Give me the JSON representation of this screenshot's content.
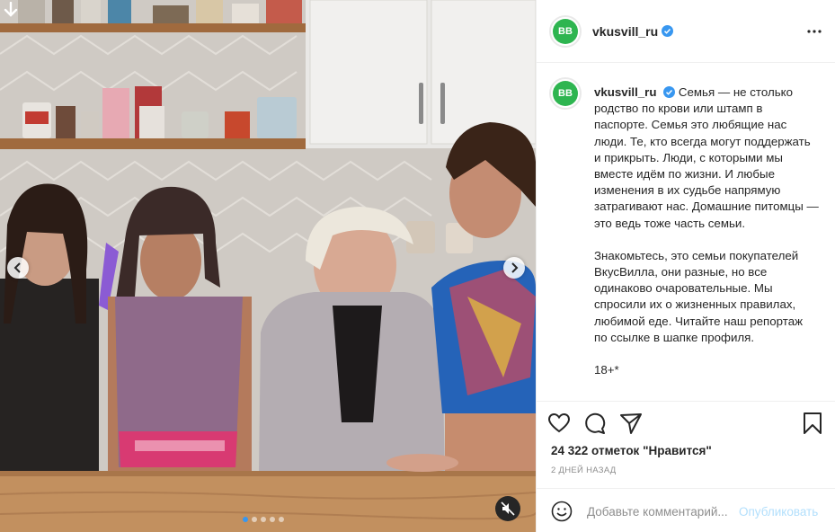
{
  "post": {
    "username": "vkusvill_ru",
    "avatar_text": "ВВ",
    "verified": true,
    "caption_p1": "Семья — не столько родство по крови или штамп в паспорте. Семья это любящие нас люди. Те, кто всегда могут поддержать и прикрыть. Люди, с которыми мы вместе идём по жизни. И любые изменения в их судьбе напрямую затрагивают нас. Домашние питомцы — это ведь тоже часть семьи.",
    "caption_p2": "Знакомьтесь, это семьи покупателей ВкусВилла, они разные, но все одинаково очаровательные. Мы спросили их о жизненных правилах, любимой еде. Читайте наш репортаж по ссылке в шапке профиля.",
    "caption_tail": "18+*",
    "likes": "24 322 отметок \"Нравится\"",
    "date": "2 ДНЕЙ НАЗАД"
  },
  "comment": {
    "placeholder": "Добавьте комментарий...",
    "publish_label": "Опубликовать"
  },
  "carousel": {
    "count": 5,
    "active": 0
  },
  "icons": [
    "download-arrow-icon",
    "chevron-left-icon",
    "chevron-right-icon",
    "mute-icon",
    "more-icon",
    "verified-icon",
    "heart-icon",
    "comment-icon",
    "share-icon",
    "bookmark-icon",
    "emoji-icon"
  ],
  "colors": {
    "accent": "#3897f0",
    "brand": "#2eb550",
    "publish_disabled": "#b2dffc"
  }
}
